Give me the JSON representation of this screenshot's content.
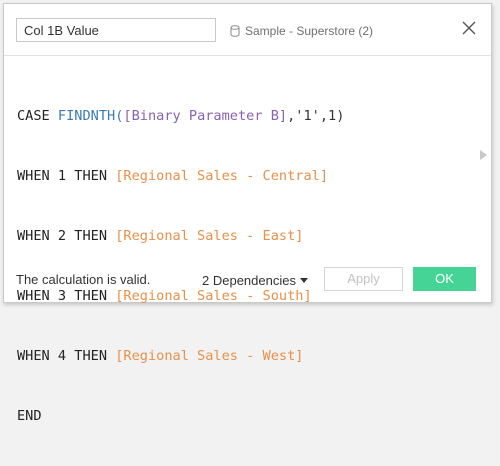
{
  "header": {
    "calc_name": "Col 1B Value",
    "datasource_label": "Sample - Superstore (2)"
  },
  "editor": {
    "line1": {
      "kw1": "CASE ",
      "fn": "FINDNTH(",
      "param": "[Binary Parameter B]",
      "rest": ",'1',1)"
    },
    "line2": {
      "kw": "WHEN 1 THEN ",
      "field": "[Regional Sales - Central]"
    },
    "line3": {
      "kw": "WHEN 2 THEN ",
      "field": "[Regional Sales - East]"
    },
    "line4": {
      "kw": "WHEN 3 THEN ",
      "field": "[Regional Sales - South]"
    },
    "line5": {
      "kw": "WHEN 4 THEN ",
      "field": "[Regional Sales - West]"
    },
    "line6": {
      "kw": "END"
    }
  },
  "footer": {
    "status": "The calculation is valid.",
    "dependencies_label": "2 Dependencies",
    "apply_label": "Apply",
    "ok_label": "OK"
  },
  "colors": {
    "ok_button": "#46d496",
    "function": "#3a7ab8",
    "parameter": "#8a62b0",
    "field": "#e8904a"
  },
  "icons": {
    "datasource": "database-icon",
    "close": "close-icon",
    "scroll": "expand-arrow-icon",
    "dependencies": "caret-down-icon"
  }
}
